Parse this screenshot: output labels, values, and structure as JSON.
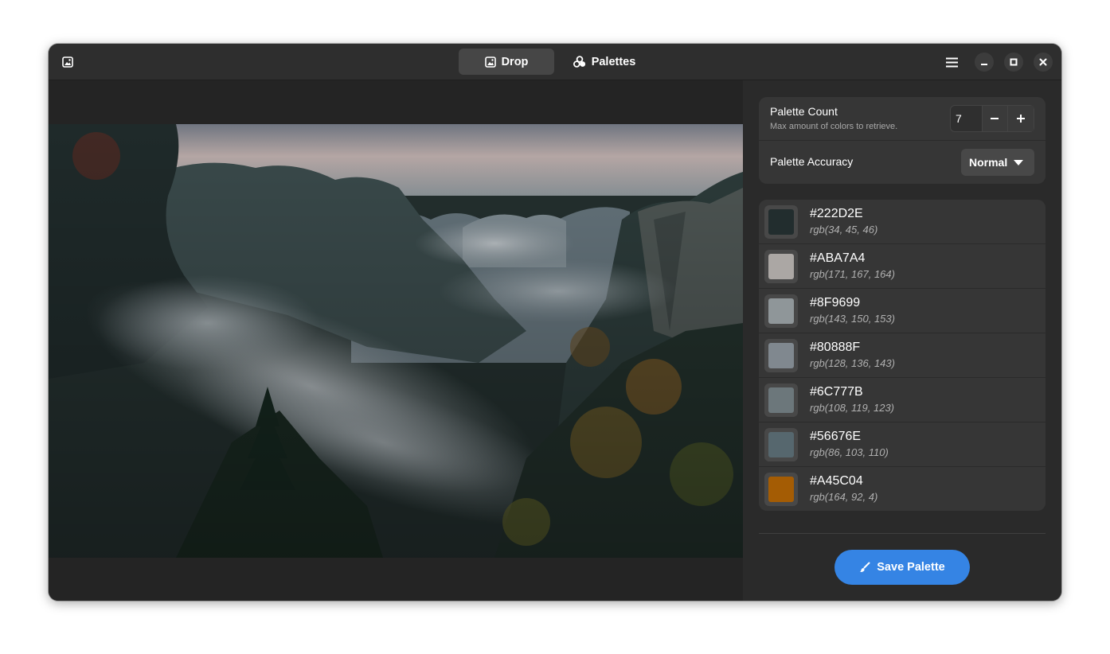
{
  "tabs": {
    "drop": "Drop",
    "palettes": "Palettes"
  },
  "settings": {
    "count_label": "Palette Count",
    "count_sub": "Max amount of colors to retrieve.",
    "count_value": "7",
    "accuracy_label": "Palette Accuracy",
    "accuracy_value": "Normal"
  },
  "colors": [
    {
      "hex": "#222D2E",
      "rgb": "rgb(34, 45, 46)"
    },
    {
      "hex": "#ABA7A4",
      "rgb": "rgb(171, 167, 164)"
    },
    {
      "hex": "#8F9699",
      "rgb": "rgb(143, 150, 153)"
    },
    {
      "hex": "#80888F",
      "rgb": "rgb(128, 136, 143)"
    },
    {
      "hex": "#6C777B",
      "rgb": "rgb(108, 119, 123)"
    },
    {
      "hex": "#56676E",
      "rgb": "rgb(86, 103, 110)"
    },
    {
      "hex": "#A45C04",
      "rgb": "rgb(164, 92, 4)"
    }
  ],
  "save_label": "Save Palette",
  "icons": {
    "app": "image-icon",
    "drop_tab": "image-icon",
    "palettes_tab": "palette-icon",
    "menu": "hamburger-menu-icon",
    "minimize": "minimize-icon",
    "maximize": "maximize-icon",
    "close": "close-icon",
    "save": "brush-icon"
  },
  "accent": "#3584e4"
}
